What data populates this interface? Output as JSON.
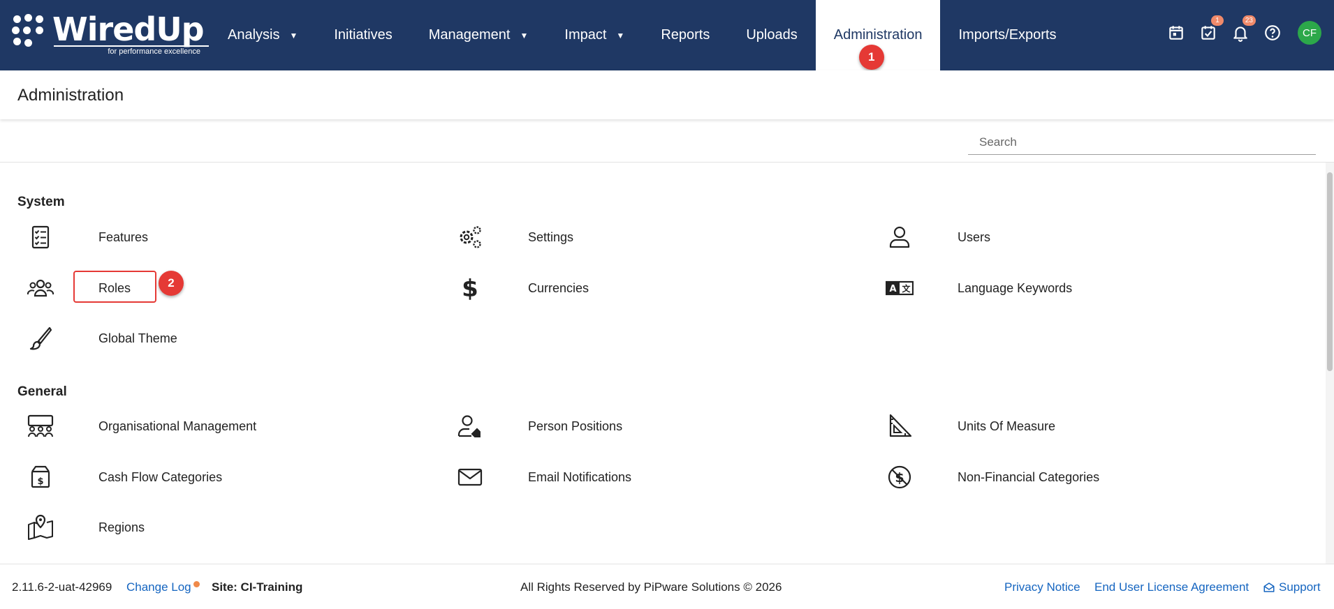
{
  "brand": {
    "logo_text": "WiredUp",
    "tagline": "for performance excellence"
  },
  "nav": {
    "items": [
      {
        "label": "Analysis",
        "has_dropdown": true
      },
      {
        "label": "Initiatives",
        "has_dropdown": false
      },
      {
        "label": "Management",
        "has_dropdown": true
      },
      {
        "label": "Impact",
        "has_dropdown": true
      },
      {
        "label": "Reports",
        "has_dropdown": false
      },
      {
        "label": "Uploads",
        "has_dropdown": false
      },
      {
        "label": "Administration",
        "has_dropdown": false,
        "active": true
      },
      {
        "label": "Imports/Exports",
        "has_dropdown": false
      }
    ],
    "icons": [
      {
        "name": "calendar-icon",
        "badge": ""
      },
      {
        "name": "task-check-icon",
        "badge": "1"
      },
      {
        "name": "bell-icon",
        "badge": "23"
      },
      {
        "name": "help-icon",
        "badge": ""
      }
    ],
    "avatar_initials": "CF"
  },
  "annotations": {
    "step1": "1",
    "step2": "2"
  },
  "page": {
    "title": "Administration",
    "search_placeholder": "Search"
  },
  "sections": {
    "system": {
      "title": "System",
      "items": [
        {
          "label": "Features",
          "icon": "checklist-icon"
        },
        {
          "label": "Settings",
          "icon": "gears-icon"
        },
        {
          "label": "Users",
          "icon": "user-icon"
        },
        {
          "label": "Roles",
          "icon": "group-icon"
        },
        {
          "label": "Currencies",
          "icon": "dollar-icon"
        },
        {
          "label": "Language Keywords",
          "icon": "language-icon"
        },
        {
          "label": "Global Theme",
          "icon": "brush-icon"
        }
      ]
    },
    "general": {
      "title": "General",
      "items": [
        {
          "label": "Organisational Management",
          "icon": "org-icon"
        },
        {
          "label": "Person Positions",
          "icon": "person-tag-icon"
        },
        {
          "label": "Units Of Measure",
          "icon": "ruler-triangle-icon"
        },
        {
          "label": "Cash Flow Categories",
          "icon": "money-box-icon"
        },
        {
          "label": "Email Notifications",
          "icon": "envelope-icon"
        },
        {
          "label": "Non-Financial Categories",
          "icon": "no-dollar-icon"
        },
        {
          "label": "Regions",
          "icon": "map-pin-icon"
        }
      ]
    }
  },
  "footer": {
    "version": "2.11.6-2-uat-42969",
    "changelog": "Change Log",
    "site": "Site: CI-Training",
    "copyright": "All Rights Reserved by PiPware Solutions © 2026",
    "privacy": "Privacy Notice",
    "eula": "End User License Agreement",
    "support": "Support"
  },
  "colors": {
    "navbar": "#1f3864",
    "accent_red": "#e53935",
    "link": "#1565c0",
    "avatar": "#2ca84a"
  }
}
